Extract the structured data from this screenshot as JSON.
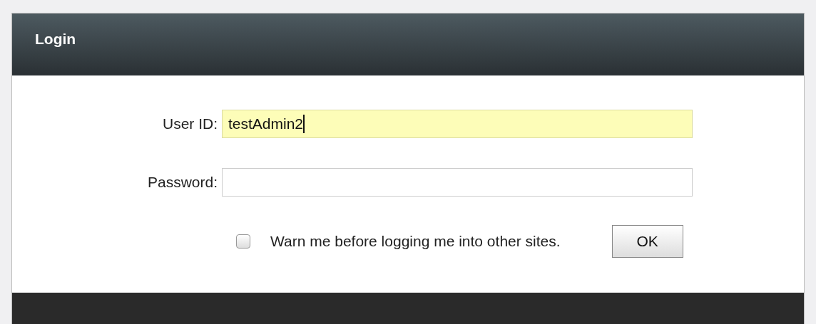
{
  "dialog": {
    "title": "Login"
  },
  "fields": [
    {
      "label": "User ID:",
      "value": "testAdmin2",
      "focused": true
    },
    {
      "label": "Password:",
      "focused": false
    }
  ],
  "warn_checkbox": {
    "label": "Warn me before logging me into other sites.",
    "checked": false
  },
  "buttons": [
    "OK"
  ]
}
